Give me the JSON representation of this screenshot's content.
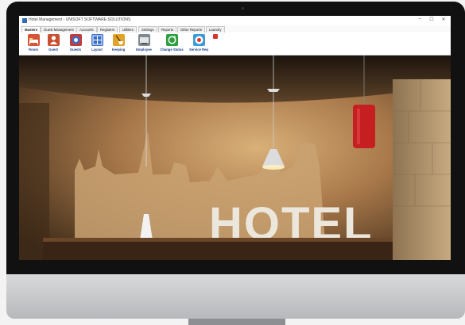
{
  "window": {
    "title": "Hotel Management - UNISOFT SOFTWARE SOLUTIONS",
    "controls": {
      "minimize": "–",
      "maximize": "☐",
      "close": "✕"
    }
  },
  "menu": {
    "tabs": [
      "Masters",
      "Guest Management",
      "Accounts",
      "Registers",
      "Utilities",
      "Settings",
      "Reports",
      "Other Reports",
      "Laundry"
    ],
    "active_index": 0
  },
  "toolbar": {
    "items": [
      {
        "label": "Room",
        "icon": "bed-icon",
        "color": "#d5553a"
      },
      {
        "label": "Guest",
        "icon": "guest-icon",
        "color": "#c8502f"
      },
      {
        "label": "Guests",
        "icon": "guests-icon",
        "color": "#c23b3b"
      },
      {
        "label": "Layout",
        "icon": "layout-icon",
        "color": "#3a6fc8"
      },
      {
        "label": "Keeping",
        "icon": "housekeeping-icon",
        "color": "#e0a228"
      },
      {
        "label": "Employee",
        "icon": "employee-icon",
        "color": "#7d8a96"
      },
      {
        "label": "Change Status",
        "icon": "refresh-icon",
        "color": "#2e9e3e"
      },
      {
        "label": "Service Req",
        "icon": "service-request-icon",
        "color": "#3c9ad6"
      }
    ]
  },
  "workspace": {
    "sign_text": "HOTEL"
  }
}
